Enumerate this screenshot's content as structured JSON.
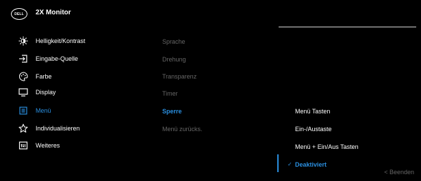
{
  "header": {
    "logo_text": "DELL",
    "title": "2X Monitor"
  },
  "menu": [
    {
      "label": "Helligkeit/Kontrast",
      "icon": "brightness-icon"
    },
    {
      "label": "Eingabe-Quelle",
      "icon": "input-source-icon"
    },
    {
      "label": "Farbe",
      "icon": "color-palette-icon"
    },
    {
      "label": "Display",
      "icon": "display-icon"
    },
    {
      "label": "Menü",
      "icon": "menu-icon",
      "active": true
    },
    {
      "label": "Individualisieren",
      "icon": "star-icon"
    },
    {
      "label": "Weiteres",
      "icon": "others-icon"
    }
  ],
  "submenu": [
    {
      "label": "Sprache"
    },
    {
      "label": "Drehung"
    },
    {
      "label": "Transparenz"
    },
    {
      "label": "Timer"
    },
    {
      "label": "Sperre",
      "active": true
    },
    {
      "label": "Menü zurücks."
    }
  ],
  "options": [
    {
      "label": "Menü Tasten"
    },
    {
      "label": "Ein-/Austaste"
    },
    {
      "label": "Menü + Ein/Aus Tasten"
    },
    {
      "label": "Deaktiviert",
      "selected": true
    }
  ],
  "footer": {
    "exit_label": "< Beenden"
  },
  "colors": {
    "accent": "#2a8fe0",
    "background": "#000000",
    "dim_text": "#666666"
  }
}
